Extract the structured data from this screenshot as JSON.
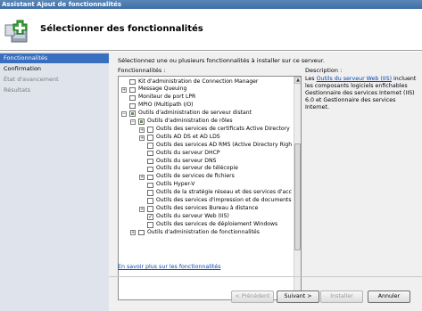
{
  "window": {
    "title": "Assistant Ajout de fonctionnalités"
  },
  "header": {
    "title": "Sélectionner des fonctionnalités",
    "icon": "wizard-features-icon"
  },
  "nav": {
    "items": [
      {
        "label": "Fonctionnalités",
        "state": "selected"
      },
      {
        "label": "Confirmation",
        "state": "normal"
      },
      {
        "label": "État d'avancement",
        "state": "disabled"
      },
      {
        "label": "Résultats",
        "state": "disabled"
      }
    ]
  },
  "content": {
    "instruction": "Sélectionnez une ou plusieurs fonctionnalités à installer sur ce serveur.",
    "features_label": "Fonctionnalités :",
    "description_label": "Description :",
    "description_prefix": "Les ",
    "description_link": "Outils du serveur Web (IIS)",
    "description_suffix": " incluent les composants logiciels enfichables Gestionnaire des services Internet (IIS) 6.0 et Gestionnaire des services Internet.",
    "more_info_link": "En savoir plus sur les fonctionnalités"
  },
  "tree": [
    {
      "label": "Kit d'administration de Connection Manager",
      "level": 0,
      "expander": "",
      "check": "unchecked"
    },
    {
      "label": "Message Queuing",
      "level": 0,
      "expander": "+",
      "check": "unchecked"
    },
    {
      "label": "Moniteur de port LPR",
      "level": 0,
      "expander": "",
      "check": "unchecked"
    },
    {
      "label": "MPIO (Multipath I/O)",
      "level": 0,
      "expander": "",
      "check": "unchecked"
    },
    {
      "label": "Outils d'administration de serveur distant",
      "level": 0,
      "expander": "−",
      "check": "partial"
    },
    {
      "label": "Outils d'administration de rôles",
      "level": 1,
      "expander": "−",
      "check": "partial"
    },
    {
      "label": "Outils des services de certificats Active Directory",
      "level": 2,
      "expander": "+",
      "check": "unchecked"
    },
    {
      "label": "Outils AD DS et AD LDS",
      "level": 2,
      "expander": "+",
      "check": "unchecked"
    },
    {
      "label": "Outils des services AD RMS (Active Directory Righ",
      "level": 2,
      "expander": "",
      "check": "unchecked"
    },
    {
      "label": "Outils du serveur DHCP",
      "level": 2,
      "expander": "",
      "check": "unchecked"
    },
    {
      "label": "Outils du serveur DNS",
      "level": 2,
      "expander": "",
      "check": "unchecked"
    },
    {
      "label": "Outils du serveur de télécopie",
      "level": 2,
      "expander": "",
      "check": "unchecked"
    },
    {
      "label": "Outils de services de fichiers",
      "level": 2,
      "expander": "+",
      "check": "unchecked"
    },
    {
      "label": "Outils Hyper-V",
      "level": 2,
      "expander": "",
      "check": "unchecked"
    },
    {
      "label": "Outils de la stratégie réseau et des services d'acc",
      "level": 2,
      "expander": "",
      "check": "unchecked"
    },
    {
      "label": "Outils des services d'impression et de documents",
      "level": 2,
      "expander": "",
      "check": "unchecked"
    },
    {
      "label": "Outils des services Bureau à distance",
      "level": 2,
      "expander": "+",
      "check": "unchecked"
    },
    {
      "label": "Outils du serveur Web (IIS)",
      "level": 2,
      "expander": "",
      "check": "checked"
    },
    {
      "label": "Outils des services de déploiement Windows",
      "level": 2,
      "expander": "",
      "check": "unchecked"
    },
    {
      "label": "Outils d'administration de fonctionnalités",
      "level": 1,
      "expander": "+",
      "check": "unchecked"
    }
  ],
  "buttons": {
    "previous": "< Précédent",
    "next": "Suivant >",
    "install": "Installer",
    "cancel": "Annuler"
  }
}
